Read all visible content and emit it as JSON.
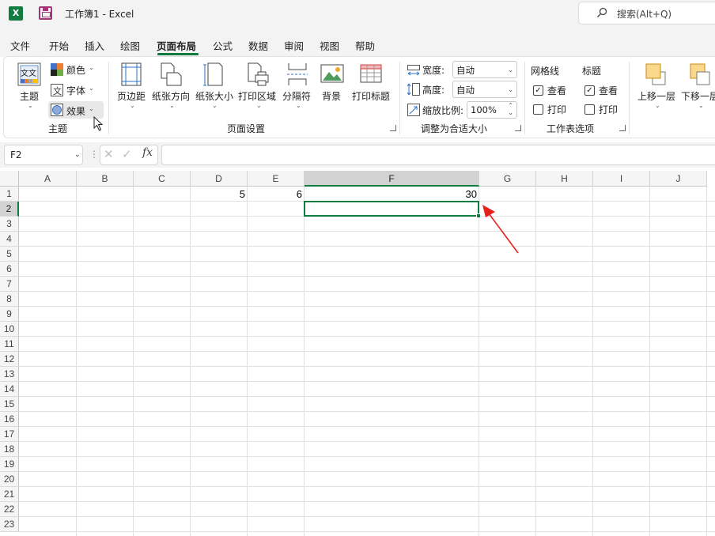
{
  "title_bar": {
    "app_logo": "X",
    "doc_title": "工作簿1  -  Excel",
    "search_placeholder": "搜索(Alt+Q)"
  },
  "menu": {
    "tabs": [
      "文件",
      "开始",
      "插入",
      "绘图",
      "页面布局",
      "公式",
      "数据",
      "审阅",
      "视图",
      "帮助"
    ],
    "active_tab": "页面布局"
  },
  "ribbon": {
    "theme_group": {
      "label": "主题",
      "theme_button": "主题",
      "theme_icon_text": "文文",
      "colors": "颜色",
      "fonts": "字体",
      "effects": "效果"
    },
    "page_setup_group": {
      "label": "页面设置",
      "margins": "页边距",
      "orientation": "纸张方向",
      "size": "纸张大小",
      "print_area": "打印区域",
      "breaks": "分隔符",
      "background": "背景",
      "print_titles": "打印标题"
    },
    "scale_group": {
      "label": "调整为合适大小",
      "width_label": "宽度:",
      "width_value": "自动",
      "height_label": "高度:",
      "height_value": "自动",
      "scale_label": "缩放比例:",
      "scale_value": "100%"
    },
    "sheet_options_group": {
      "label": "工作表选项",
      "gridlines": "网格线",
      "headings": "标题",
      "view": "查看",
      "print": "打印",
      "gridlines_view_checked": true,
      "gridlines_print_checked": false,
      "headings_view_checked": true,
      "headings_print_checked": false
    },
    "arrange_group": {
      "bring_forward": "上移一层",
      "send_backward": "下移一层"
    }
  },
  "formula_bar": {
    "name_box": "F2",
    "fx": "fx",
    "formula": ""
  },
  "sheet": {
    "columns": [
      "A",
      "B",
      "C",
      "D",
      "E",
      "F",
      "G",
      "H",
      "I",
      "J"
    ],
    "rows": [
      "1",
      "2",
      "3",
      "4",
      "5",
      "6",
      "7",
      "8",
      "9",
      "10",
      "11",
      "12",
      "13",
      "14",
      "15",
      "16",
      "17",
      "18",
      "19",
      "20",
      "21",
      "22",
      "23"
    ],
    "selected_cell": "F2",
    "cells": {
      "D1": "5",
      "E1": "6",
      "F1": "30"
    }
  },
  "colors": {
    "accent_green": "#107c41",
    "annotation_arrow": "#e8211d"
  }
}
